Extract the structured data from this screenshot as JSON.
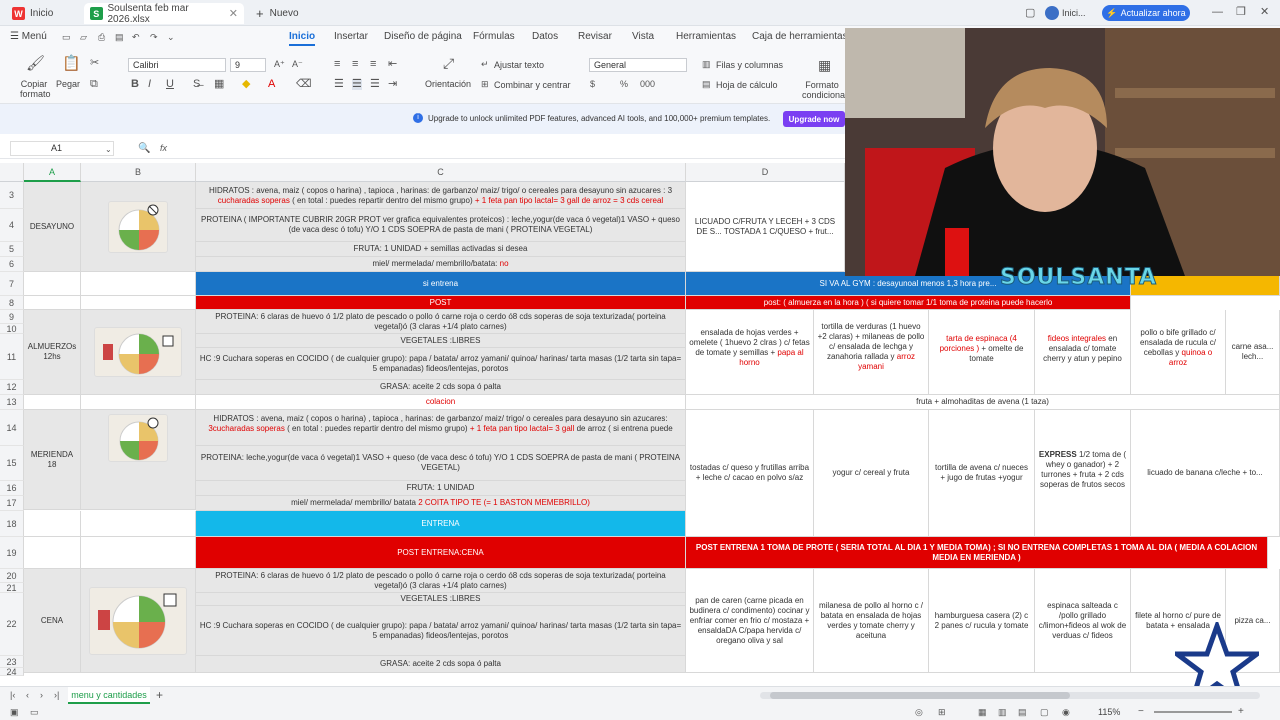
{
  "tabs": [
    {
      "label": "Inicio"
    },
    {
      "label": "Soulsenta feb mar 2026.xlsx"
    },
    {
      "label": "Nuevo"
    }
  ],
  "window": {
    "upgrade_label": "Actualizar ahora",
    "account_label": "Inici..."
  },
  "menu": {
    "menu_label": "Menú",
    "items": [
      "Inicio",
      "Insertar",
      "Diseño de página",
      "Fórmulas",
      "Datos",
      "Revisar",
      "Vista",
      "Herramientas",
      "Caja de herramientas im"
    ]
  },
  "ribbon": {
    "copy_format": "Copiar formato",
    "paste": "Pegar",
    "font": "Calibri",
    "size": "9",
    "wrap": "Ajustar texto",
    "merge": "Combinar y centrar",
    "orientation": "Orientación",
    "number_format": "General",
    "rows_cols": "Filas y columnas",
    "sheet": "Hoja de cálculo",
    "cond_format": "Formato condiciona",
    "fmt": "Formato"
  },
  "banner": {
    "text": "Upgrade to unlock unlimited PDF features, advanced AI tools, and 100,000+ premium templates.",
    "button": "Upgrade now"
  },
  "formula": {
    "cell_ref": "A1",
    "fx": "fx"
  },
  "columns": [
    "A",
    "B",
    "C",
    "D"
  ],
  "rows": {
    "r3c": "HIDRATOS : avena, maiz ( copos o harina) , tapioca , harinas: de garbanzo/ maiz/ trigo/ o cereales para desayuno sin azucares : 3",
    "r3c2": "cucharadas soperas",
    "r3c3": "( en total : puedes repartir dentro del mismo grupo)",
    "r3c4": "+ 1 feta pan tipo lactal= 3 gall de arroz = 3 cds cereal",
    "desayuno": "DESAYUNO",
    "r4c": "PROTEINA ( IMPORTANTE CUBRIR 20GR PROT ver grafica equivalentes proteicos) : leche,yogur(de vaca ó vegetal)1 VASO + queso (de vaca desc ó tofu) Y/O 1 CDS SOEPRA de pasta de mani ( PROTEINA VEGETAL)",
    "r4d": "LICUADO C/FRUTA Y LECEH + 3 CDS DE S... TOSTADA 1 C/QUESO + frut...",
    "r5c": "FRUTA: 1 UNIDAD + semillas activadas si desea",
    "r6c": "miel/ mermelada/ membrillo/batata:",
    "r6c_red": "no",
    "r7c": "si entrena",
    "r7d": "SI VA AL GYM : desayunoal menos 1,3 hora pre...",
    "r8c": "POST",
    "r8d": "post: ( almuerza en la hora ) ( si quiere tomar 1/1 toma de proteina puede hacerlo",
    "almuerzo": "ALMUERZOs 12hs",
    "r9c": "PROTEINA: 6 claras de huevo ó 1/2 plato de pescado o pollo ó carne roja o cerdo ó8 cds soperas de soja texturizada( porteina vegetal)ó (3 claras +1/4 plato carnes)",
    "r10c": "VEGETALES :LIBRES",
    "r11c": "HC :9 Cuchara soperas en COCIDO ( de cualquier grupo): papa / batata/ arroz yamani/ quinoa/ harinas/ tarta masas (1/2 tarta sin tapa= 5 empanadas) fideos/lentejas, porotos",
    "r12c": "GRASA: aceite 2 cds sopa ó palta",
    "r9d": "ensalada de hojas verdes + omelete ( 1huevo 2 clras ) c/ fetas de tomate y semillas +",
    "r9d_red": "papa al horno",
    "r9e": "tortilla de verduras (1 huevo +2 claras) + milaneas de pollo c/ ensalada de lechga y zanahoria rallada y",
    "r9e_red": "arroz yamani",
    "r9f_red": "tarta de espinaca (4 porciones )",
    "r9f": "+ omelte de tomate",
    "r9g_red": "fideos integrales",
    "r9g": "en ensalada c/ tomate cherry y atun y pepino",
    "r9h": "pollo o bife grillado c/ ensalada de rucula c/ cebollas y",
    "r9h_red": "quinoa o arroz",
    "r9i": "carne asa... lech...",
    "r13c": "colacion",
    "r13d": "fruta + almohaditas de avena (1 taza)",
    "merienda": "MERIENDA 18",
    "r14c": "HIDRATOS : avena, maiz ( copos o harina) , tapioca , harinas: de garbanzo/ maiz/ trigo/ o cereales para desayuno sin azucares:",
    "r14c2": "3cucharadas soperas",
    "r14c3": "( en total : puedes repartir dentro del mismo grupo)",
    "r14c4": "+ 1 feta pan tipo lactal= 3 gall",
    "r14c5": "de arroz ( si entrena puede",
    "r15c": "PROTEINA: leche,yogur(de vaca ó vegetal)1 VASO + queso (de vaca desc ó tofu) Y/O 1 CDS SOEPRA de pasta de mani ( PROTEINA VEGETAL)",
    "r16c": "FRUTA: 1 UNIDAD",
    "r17c": "miel/ mermelada/ membrillo/ batata",
    "r17c_red": "2 COITA TIPO TE (= 1 BASTON MEMEBRILLO)",
    "r15d": "tostadas c/ queso y frutillas arriba + leche c/ cacao en polvo s/az",
    "r15e": "yogur c/ cereal y fruta",
    "r15f": "tortilla de avena c/ nueces + jugo de frutas +yogur",
    "r15g_b": "EXPRESS",
    "r15g": "1/2 toma de ( whey o ganador) + 2 turrones + fruta + 2 cds soperas de frutos secos",
    "r15h": "licuado de banana c/leche + to...",
    "r18c": "ENTRENA",
    "r19c": "POST ENTRENA:CENA",
    "r19d": "POST ENTRENA 1 TOMA DE PROTE ( SERIA TOTAL AL DIA 1 Y MEDIA TOMA) ; SI NO ENTRENA COMPLETAS 1 TOMA AL DIA ( MEDIA A COLACION MEDIA EN MERIENDA )",
    "cena": "CENA",
    "r20c": "PROTEINA: 6 claras de huevo ó 1/2 plato de pescado o pollo ó carne roja o cerdo ó8 cds soperas de soja texturizada( porteina vegetal)ó (3 claras +1/4 plato carnes)",
    "r21c": "VEGETALES :LIBRES",
    "r22c": "HC :9 Cuchara soperas en COCIDO ( de cualquier grupo): papa / batata/ arroz yamani/ quinoa/ harinas/ tarta masas (1/2 tarta sin tapa= 5 empanadas) fideos/lentejas, porotos",
    "r24c": "GRASA: aceite 2 cds sopa ó palta",
    "r20d": "pan de caren (carne picada en budinera c/ condimento) cocinar y enfriar comer en frio c/ mostaza + ensaldaDA C/papa hervida c/ oregano oliva y sal",
    "r20e": "milanesa de pollo al horno c / batata en ensalada de hojas verdes y tomate cherry y aceituna",
    "r20f": "hamburguesa casera (2) c 2 panes c/ rucula y tomate",
    "r20g": "espinaca salteada c /pollo grillado c/limon+fideos al wok de verduas c/ fideos",
    "r20h": "filete al horno c/ pure de batata + ensalada",
    "r20i": "pizza ca..."
  },
  "row_numbers": [
    "3",
    "4",
    "5",
    "6",
    "7",
    "8",
    "9",
    "10",
    "11",
    "12",
    "13",
    "14",
    "15",
    "16",
    "17",
    "18",
    "19",
    "20",
    "21",
    "22",
    "23",
    "24"
  ],
  "sheet_tab": "menu y cantidades",
  "status": {
    "zoom": "115%"
  },
  "stream": {
    "overlay_text": "SOULSANTA"
  },
  "colors": {
    "accent": "#1a6fd8",
    "red": "#e00000",
    "blue_band": "#1a74c6",
    "cyan_band": "#13b8ea",
    "gray": "#e7e7e7"
  }
}
